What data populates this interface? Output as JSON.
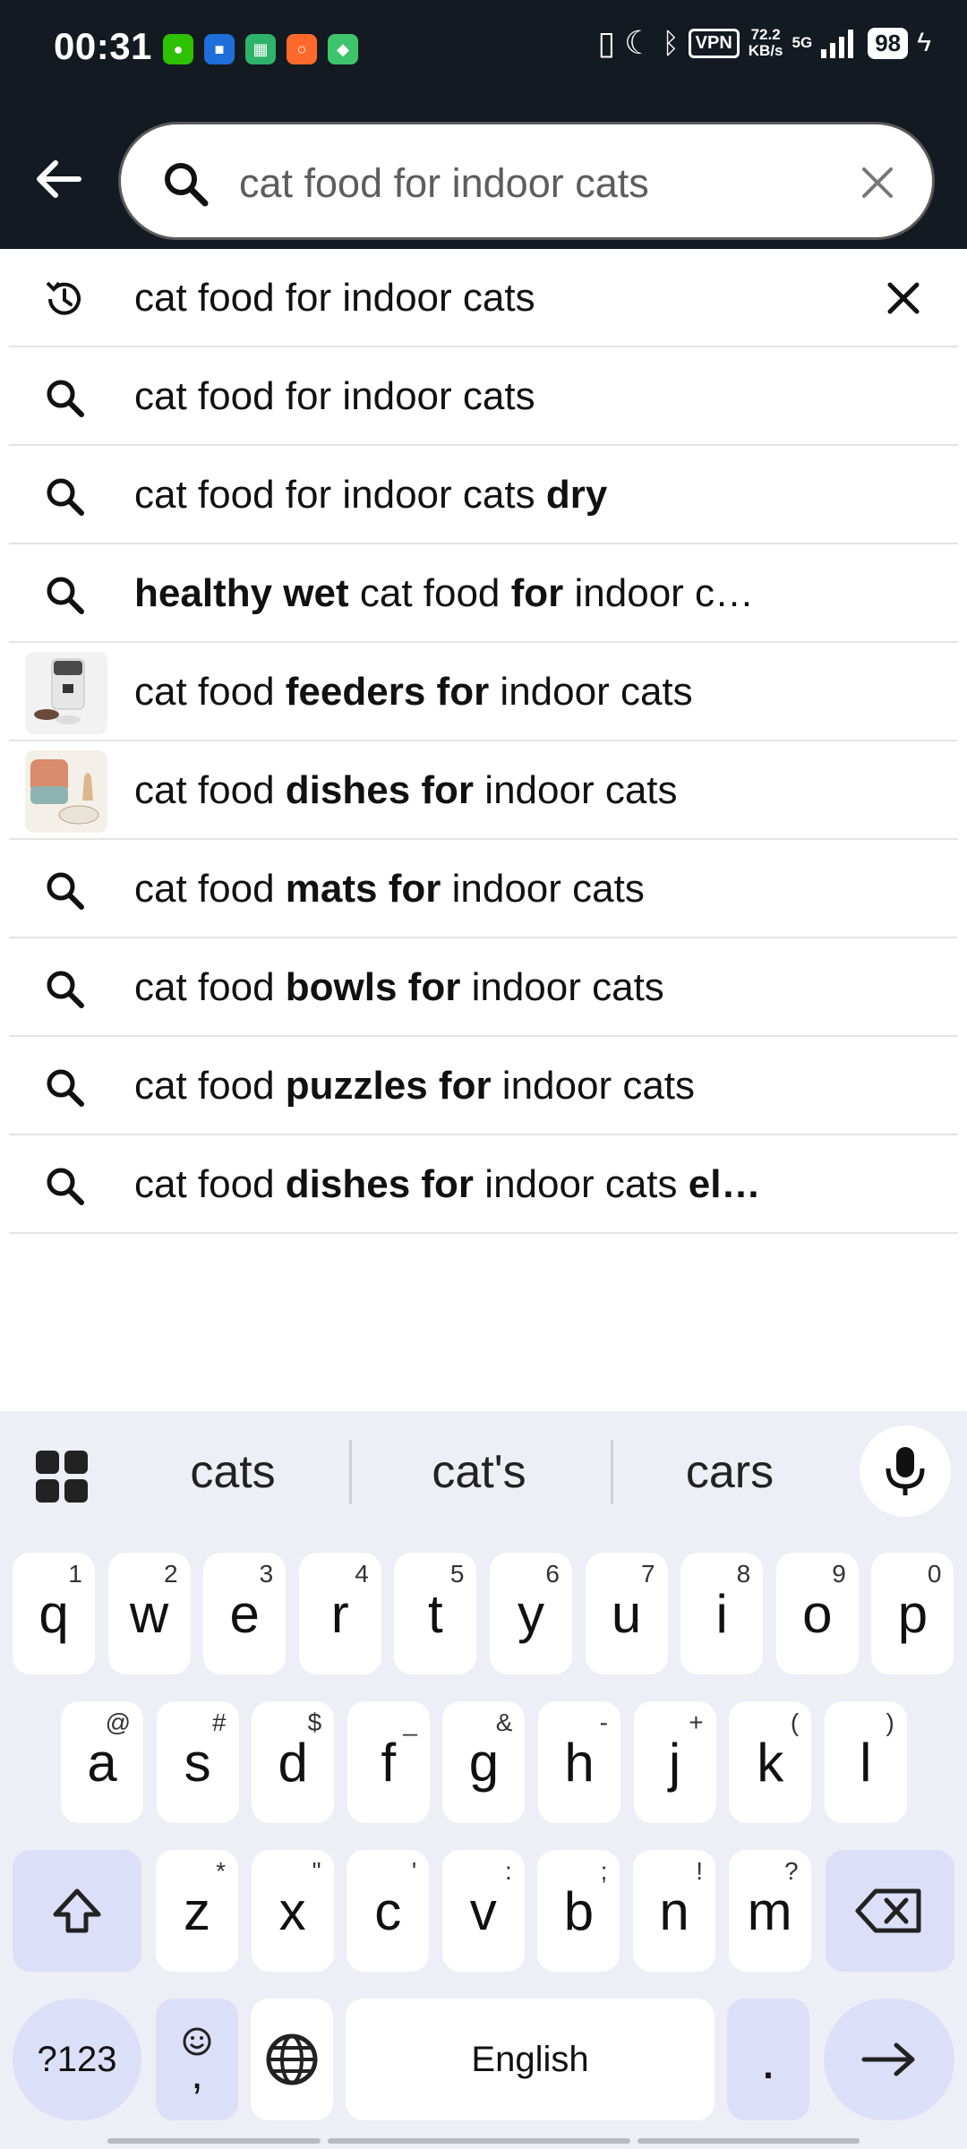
{
  "status": {
    "time": "00:31",
    "vpn": "VPN",
    "speed_value": "72.2",
    "speed_unit": "KB/s",
    "network": "5G",
    "battery": "98"
  },
  "search": {
    "query": "cat food for indoor cats"
  },
  "suggestions": [
    {
      "type": "history",
      "parts": [
        {
          "t": "cat food for indoor cats",
          "b": false
        }
      ]
    },
    {
      "type": "search",
      "parts": [
        {
          "t": "cat food for indoor cats",
          "b": false
        }
      ]
    },
    {
      "type": "search",
      "parts": [
        {
          "t": "cat food for indoor cats ",
          "b": false
        },
        {
          "t": "dry",
          "b": true
        }
      ]
    },
    {
      "type": "search",
      "parts": [
        {
          "t": "healthy wet",
          "b": true
        },
        {
          "t": " cat food ",
          "b": false
        },
        {
          "t": "for",
          "b": true
        },
        {
          "t": " indoor c…",
          "b": false
        }
      ]
    },
    {
      "type": "image-feeder",
      "parts": [
        {
          "t": "cat food ",
          "b": false
        },
        {
          "t": "feeders for",
          "b": true
        },
        {
          "t": " indoor cats",
          "b": false
        }
      ]
    },
    {
      "type": "image-dish",
      "parts": [
        {
          "t": "cat food ",
          "b": false
        },
        {
          "t": "dishes for",
          "b": true
        },
        {
          "t": " indoor cats",
          "b": false
        }
      ]
    },
    {
      "type": "search",
      "parts": [
        {
          "t": "cat food ",
          "b": false
        },
        {
          "t": "mats for",
          "b": true
        },
        {
          "t": " indoor cats",
          "b": false
        }
      ]
    },
    {
      "type": "search",
      "parts": [
        {
          "t": "cat food ",
          "b": false
        },
        {
          "t": "bowls for",
          "b": true
        },
        {
          "t": " indoor cats",
          "b": false
        }
      ]
    },
    {
      "type": "search",
      "parts": [
        {
          "t": "cat food ",
          "b": false
        },
        {
          "t": "puzzles for",
          "b": true
        },
        {
          "t": " indoor cats",
          "b": false
        }
      ]
    },
    {
      "type": "search",
      "parts": [
        {
          "t": "cat food ",
          "b": false
        },
        {
          "t": "dishes for",
          "b": true
        },
        {
          "t": " indoor cats ",
          "b": false
        },
        {
          "t": "el…",
          "b": true
        }
      ]
    }
  ],
  "keyboard": {
    "suggestions": [
      "cats",
      "cat's",
      "cars"
    ],
    "row1": [
      {
        "k": "q",
        "s": "1"
      },
      {
        "k": "w",
        "s": "2"
      },
      {
        "k": "e",
        "s": "3"
      },
      {
        "k": "r",
        "s": "4"
      },
      {
        "k": "t",
        "s": "5"
      },
      {
        "k": "y",
        "s": "6"
      },
      {
        "k": "u",
        "s": "7"
      },
      {
        "k": "i",
        "s": "8"
      },
      {
        "k": "o",
        "s": "9"
      },
      {
        "k": "p",
        "s": "0"
      }
    ],
    "row2": [
      {
        "k": "a",
        "s": "@"
      },
      {
        "k": "s",
        "s": "#"
      },
      {
        "k": "d",
        "s": "$"
      },
      {
        "k": "f",
        "s": "_"
      },
      {
        "k": "g",
        "s": "&"
      },
      {
        "k": "h",
        "s": "-"
      },
      {
        "k": "j",
        "s": "+"
      },
      {
        "k": "k",
        "s": "("
      },
      {
        "k": "l",
        "s": ")"
      }
    ],
    "row3": [
      {
        "k": "z",
        "s": "*"
      },
      {
        "k": "x",
        "s": "\""
      },
      {
        "k": "c",
        "s": "'"
      },
      {
        "k": "v",
        "s": ":"
      },
      {
        "k": "b",
        "s": ";"
      },
      {
        "k": "n",
        "s": "!"
      },
      {
        "k": "m",
        "s": "?"
      }
    ],
    "symbols_label": "?123",
    "comma_label": ",",
    "space_label": "English",
    "period_label": "."
  },
  "colors": {
    "header_bg": "#131a22",
    "keyboard_bg": "#eeeef6",
    "function_key_bg": "#dcdff8"
  },
  "icons": [
    "back-arrow-icon",
    "search-icon",
    "clear-icon",
    "history-icon",
    "close-icon",
    "grid-icon",
    "microphone-icon",
    "shift-icon",
    "backspace-icon",
    "emoji-icon",
    "globe-icon",
    "enter-arrow-icon"
  ]
}
